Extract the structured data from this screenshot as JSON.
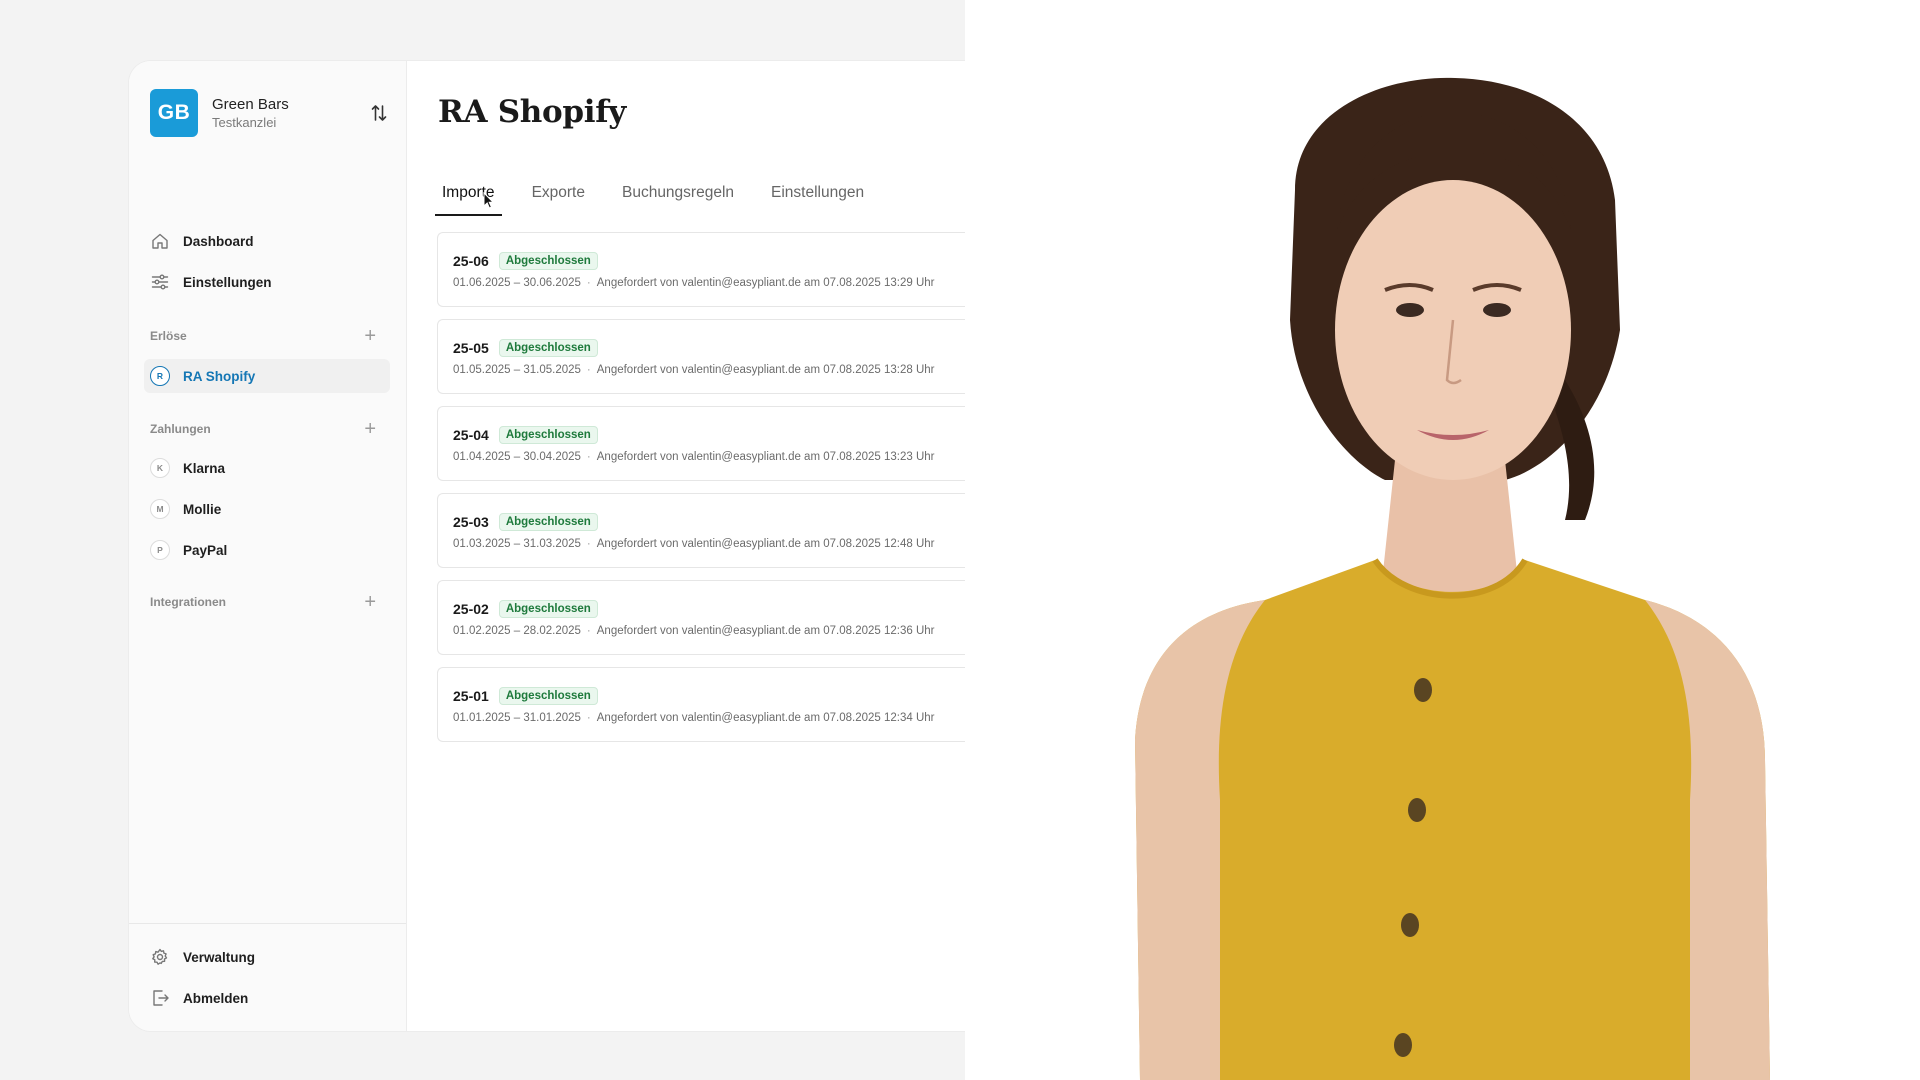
{
  "account": {
    "initials": "GB",
    "name": "Green Bars",
    "subtitle": "Testkanzlei",
    "brand_color": "#1a9bd8"
  },
  "nav": {
    "dashboard": "Dashboard",
    "settings": "Einstellungen"
  },
  "sections": {
    "revenue": {
      "title": "Erlöse",
      "items": [
        {
          "letter": "R",
          "label": "RA Shopify",
          "active": true
        }
      ]
    },
    "payments": {
      "title": "Zahlungen",
      "items": [
        {
          "letter": "K",
          "label": "Klarna"
        },
        {
          "letter": "M",
          "label": "Mollie"
        },
        {
          "letter": "P",
          "label": "PayPal"
        }
      ]
    },
    "integrations": {
      "title": "Integrationen"
    }
  },
  "footer": {
    "admin": "Verwaltung",
    "logout": "Abmelden"
  },
  "main": {
    "title": "RA Shopify",
    "tabs": [
      "Importe",
      "Exporte",
      "Buchungsregeln",
      "Einstellungen"
    ],
    "active_tab": "Importe",
    "imports": [
      {
        "id": "25-06",
        "status": "Abgeschlossen",
        "range": "01.06.2025 – 30.06.2025",
        "requested": "Angefordert von valentin@easypliant.de am 07.08.2025 13:29 Uhr"
      },
      {
        "id": "25-05",
        "status": "Abgeschlossen",
        "range": "01.05.2025 – 31.05.2025",
        "requested": "Angefordert von valentin@easypliant.de am 07.08.2025 13:28 Uhr"
      },
      {
        "id": "25-04",
        "status": "Abgeschlossen",
        "range": "01.04.2025 – 30.04.2025",
        "requested": "Angefordert von valentin@easypliant.de am 07.08.2025 13:23 Uhr"
      },
      {
        "id": "25-03",
        "status": "Abgeschlossen",
        "range": "01.03.2025 – 31.03.2025",
        "requested": "Angefordert von valentin@easypliant.de am 07.08.2025 12:48 Uhr"
      },
      {
        "id": "25-02",
        "status": "Abgeschlossen",
        "range": "01.02.2025 – 28.02.2025",
        "requested": "Angefordert von valentin@easypliant.de am 07.08.2025 12:36 Uhr"
      },
      {
        "id": "25-01",
        "status": "Abgeschlossen",
        "range": "01.01.2025 – 31.01.2025",
        "requested": "Angefordert von valentin@easypliant.de am 07.08.2025 12:34 Uhr"
      }
    ]
  },
  "colors": {
    "accent": "#1577b5",
    "status_green": "#1e7a3c",
    "presenter_shirt": "#d9ac2b"
  }
}
